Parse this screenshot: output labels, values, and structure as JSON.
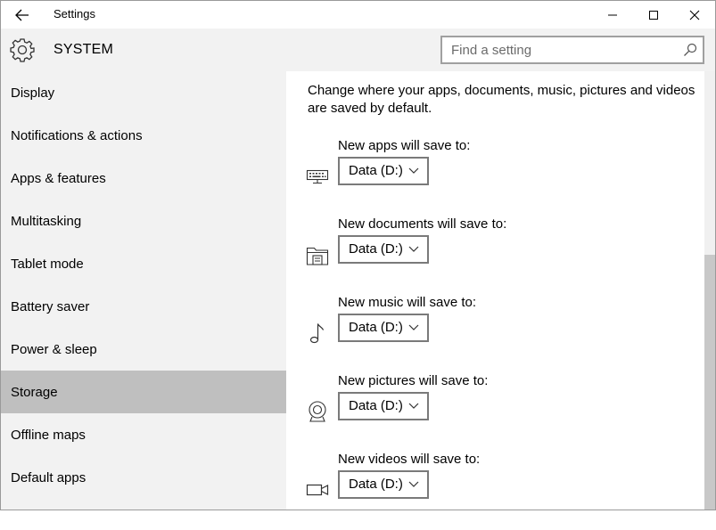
{
  "window": {
    "title": "Settings"
  },
  "header": {
    "title": "SYSTEM",
    "icon": "gear-icon"
  },
  "search": {
    "placeholder": "Find a setting",
    "value": ""
  },
  "sidebar": {
    "items": [
      {
        "label": "Display",
        "selected": false
      },
      {
        "label": "Notifications & actions",
        "selected": false
      },
      {
        "label": "Apps & features",
        "selected": false
      },
      {
        "label": "Multitasking",
        "selected": false
      },
      {
        "label": "Tablet mode",
        "selected": false
      },
      {
        "label": "Battery saver",
        "selected": false
      },
      {
        "label": "Power & sleep",
        "selected": false
      },
      {
        "label": "Storage",
        "selected": true
      },
      {
        "label": "Offline maps",
        "selected": false
      },
      {
        "label": "Default apps",
        "selected": false
      }
    ]
  },
  "main": {
    "intro": "Change where your apps, documents, music, pictures and videos are saved by default.",
    "save_locations": [
      {
        "label": "New apps will save to:",
        "value": "Data (D:)",
        "icon": "monitor-keyboard-icon"
      },
      {
        "label": "New documents will save to:",
        "value": "Data (D:)",
        "icon": "documents-folder-icon"
      },
      {
        "label": "New music will save to:",
        "value": "Data (D:)",
        "icon": "music-note-icon"
      },
      {
        "label": "New pictures will save to:",
        "value": "Data (D:)",
        "icon": "camera-icon"
      },
      {
        "label": "New videos will save to:",
        "value": "Data (D:)",
        "icon": "video-camera-icon"
      }
    ]
  },
  "colors": {
    "sidebar_bg": "#f2f2f2",
    "selected_bg": "#bfbfbf",
    "content_bg": "#ffffff"
  }
}
